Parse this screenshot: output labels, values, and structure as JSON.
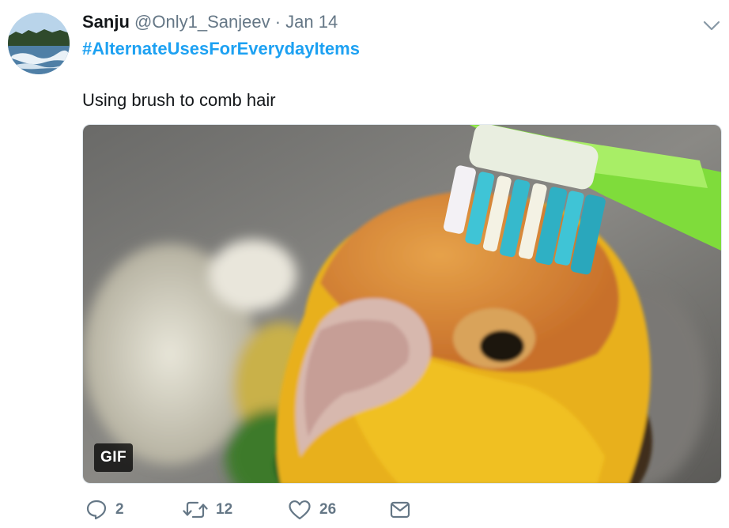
{
  "tweet": {
    "display_name": "Sanju",
    "handle": "@Only1_Sanjeev",
    "separator": "·",
    "date": "Jan 14",
    "hashtag": "#AlternateUsesForEverydayItems",
    "text": "Using brush to comb hair"
  },
  "media": {
    "badge": "GIF"
  },
  "actions": {
    "reply_count": "2",
    "retweet_count": "12",
    "like_count": "26"
  },
  "colors": {
    "link_blue": "#1da1f2",
    "muted_gray": "#657786",
    "text_dark": "#14171a"
  },
  "icons": [
    "chevron-down-icon",
    "reply-icon",
    "retweet-icon",
    "heart-icon",
    "message-icon"
  ]
}
